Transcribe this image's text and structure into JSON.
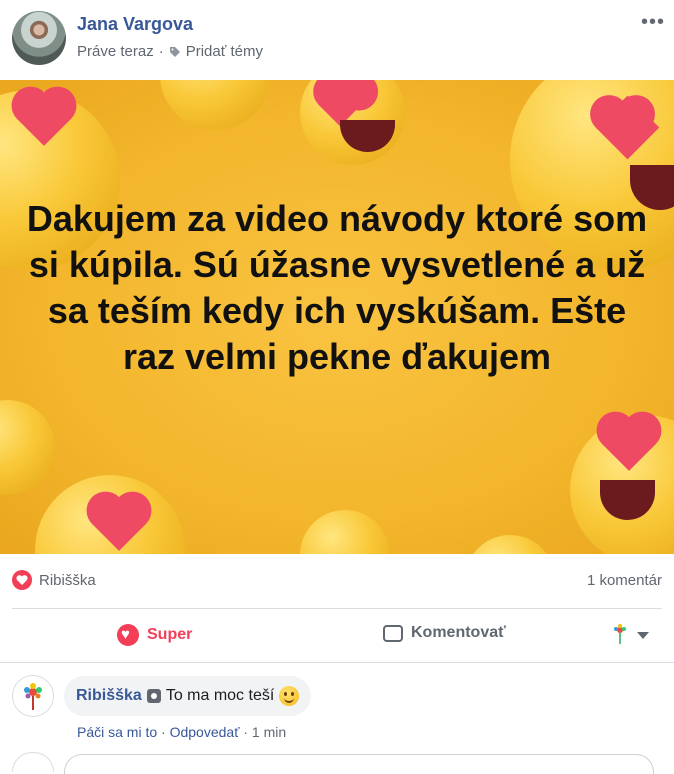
{
  "post": {
    "author": "Jana Vargova",
    "time": "Práve teraz",
    "separator": "·",
    "add_topics": "Pridať témy",
    "more_icon": "more-dots-icon",
    "text": "Dakujem za video návody ktoré som si kúpila. Sú úžasne vysvetlené a už sa teším kedy ich vyskúšam. Ešte raz velmi pekne ďakujem",
    "background_color": "#f3b62c"
  },
  "stats": {
    "reactor": "Ribišška",
    "comment_count": "1 komentár"
  },
  "actions": {
    "super_label": "Super",
    "comment_label": "Komentovať"
  },
  "comment": {
    "author": "Ribišška",
    "text": "To ma moc teší",
    "like": "Páči sa mi to",
    "reply": "Odpovedať",
    "separator": "·",
    "time": "1 min"
  },
  "colors": {
    "link": "#385898",
    "love": "#f33e58",
    "muted": "#606770"
  }
}
